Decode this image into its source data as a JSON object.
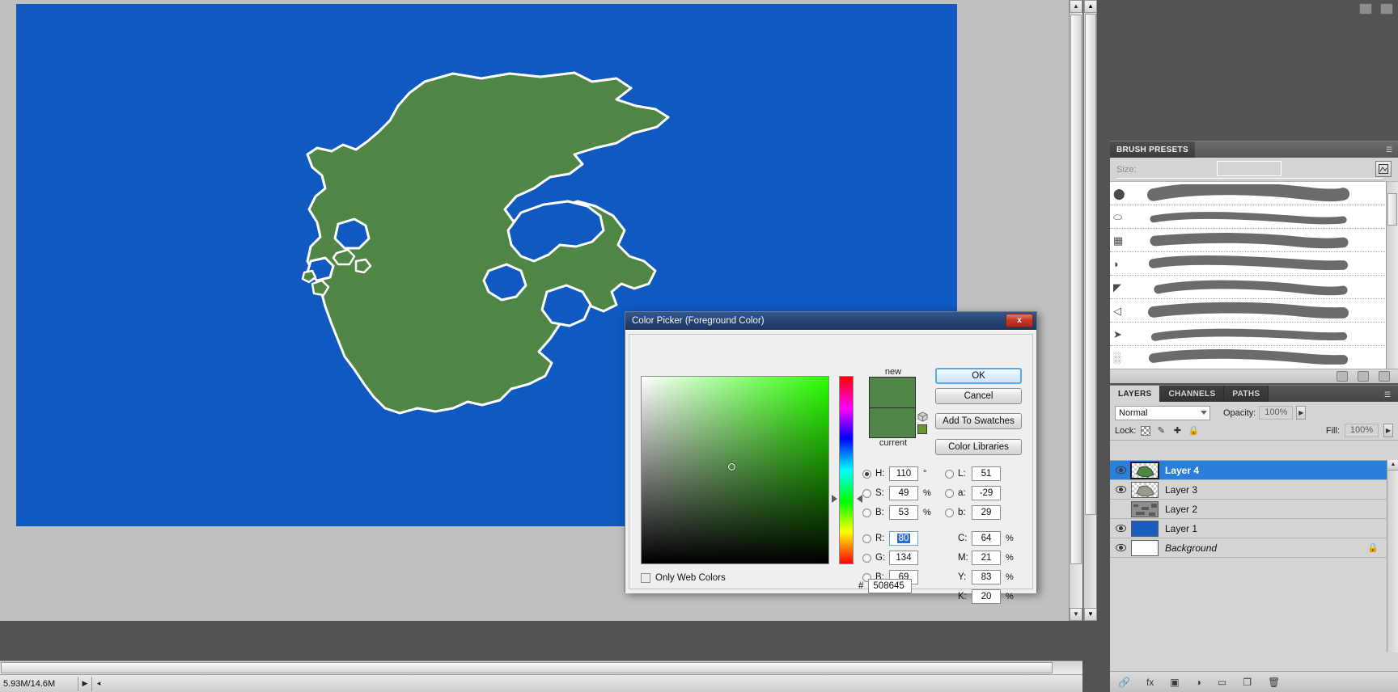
{
  "canvas": {
    "ocean_color": "#1059c0",
    "land_color": "#508645",
    "coast_outline": "#ffffff",
    "coast_shadow": "#000000",
    "doc_bg": "#c0c0c0"
  },
  "status_bar": {
    "doc_sizes": "5.93M/14.6M",
    "expand_arrow": "▶",
    "left_arrow": "◂"
  },
  "dialog": {
    "title": "Color Picker (Foreground Color)",
    "close_label": "x",
    "new_label": "new",
    "current_label": "current",
    "new_color": "#508645",
    "current_color": "#508645",
    "websafe_color": "#669933",
    "marker_hint": "sv-marker",
    "buttons": {
      "ok": "OK",
      "cancel": "Cancel",
      "add_to_swatches": "Add To Swatches",
      "color_libraries": "Color Libraries"
    },
    "hsb": [
      {
        "key": "H",
        "label": "H:",
        "value": "110",
        "unit": "°",
        "selected": true
      },
      {
        "key": "S",
        "label": "S:",
        "value": "49",
        "unit": "%",
        "selected": false
      },
      {
        "key": "B",
        "label": "B:",
        "value": "53",
        "unit": "%",
        "selected": false
      }
    ],
    "rgb": [
      {
        "key": "R",
        "label": "R:",
        "value": "80",
        "unit": "",
        "selected": false,
        "focused": true
      },
      {
        "key": "G",
        "label": "G:",
        "value": "134",
        "unit": "",
        "selected": false,
        "focused": false
      },
      {
        "key": "B2",
        "label": "B:",
        "value": "69",
        "unit": "",
        "selected": false,
        "focused": false
      }
    ],
    "lab": [
      {
        "key": "L",
        "label": "L:",
        "value": "51",
        "unit": "",
        "selected": false
      },
      {
        "key": "a",
        "label": "a:",
        "value": "-29",
        "unit": "",
        "selected": false
      },
      {
        "key": "b",
        "label": "b:",
        "value": "29",
        "unit": "",
        "selected": false
      }
    ],
    "cmyk": [
      {
        "key": "C",
        "label": "C:",
        "value": "64",
        "unit": "%"
      },
      {
        "key": "M",
        "label": "M:",
        "value": "21",
        "unit": "%"
      },
      {
        "key": "Y",
        "label": "Y:",
        "value": "83",
        "unit": "%"
      },
      {
        "key": "K",
        "label": "K:",
        "value": "20",
        "unit": "%"
      }
    ],
    "only_web_colors": "Only Web Colors",
    "only_web_checked": false,
    "hex_hash": "#",
    "hex_value": "508645"
  },
  "brush_panel": {
    "tab_label": "BRUSH PRESETS",
    "size_label": "Size:",
    "size_value": "",
    "menu_icon": "panel-menu-icon",
    "presets_count": 8
  },
  "layers_panel": {
    "tabs": [
      {
        "label": "LAYERS",
        "active": true
      },
      {
        "label": "CHANNELS",
        "active": false
      },
      {
        "label": "PATHS",
        "active": false
      }
    ],
    "blend_mode": "Normal",
    "opacity_label": "Opacity:",
    "opacity_value": "100%",
    "lock_label": "Lock:",
    "fill_label": "Fill:",
    "fill_value": "100%",
    "lock_icons": [
      "transparency-lock-icon",
      "brush-lock-icon",
      "move-lock-icon",
      "all-lock-icon"
    ],
    "layers": [
      {
        "name": "Layer 4",
        "visible": true,
        "selected": true,
        "thumb": "land-green",
        "locked": false,
        "italic": false
      },
      {
        "name": "Layer 3",
        "visible": true,
        "selected": false,
        "thumb": "land-gray",
        "locked": false,
        "italic": false
      },
      {
        "name": "Layer 2",
        "visible": false,
        "selected": false,
        "thumb": "texture",
        "locked": false,
        "italic": false
      },
      {
        "name": "Layer 1",
        "visible": true,
        "selected": false,
        "thumb": "blue-solid",
        "locked": false,
        "italic": false
      },
      {
        "name": "Background",
        "visible": true,
        "selected": false,
        "thumb": "white-solid",
        "locked": true,
        "italic": true
      }
    ],
    "footer_icons": [
      "link-layers-icon",
      "layer-style-fx-icon",
      "layer-mask-icon",
      "adjustment-layer-icon",
      "new-group-icon",
      "new-layer-icon",
      "delete-layer-icon"
    ]
  },
  "colors": {
    "selection_blue": "#2a7fdc",
    "panel_gray": "#d4d4d4",
    "app_bg": "#535353",
    "title_blue": "#24416e"
  }
}
